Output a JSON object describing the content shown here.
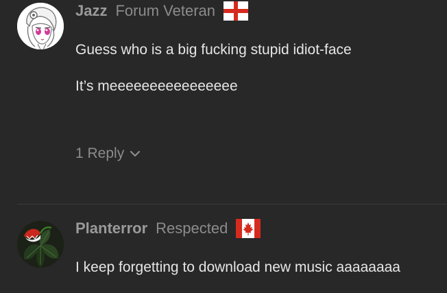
{
  "posts": [
    {
      "author": "Jazz",
      "title": "Forum Veteran",
      "flag_icon": "england-flag-icon",
      "avatar_icon": "anime-girl-avatar",
      "lines": [
        "Guess who is a big fucking stupid idiot-face",
        "It’s meeeeeeeeeeeeeeee"
      ],
      "reply_label": "1 Reply"
    },
    {
      "author": "Planterror",
      "title": "Respected",
      "flag_icon": "canada-flag-icon",
      "avatar_icon": "plant-creature-avatar",
      "lines": [
        "I keep forgetting to download new music aaaaaaaa"
      ]
    }
  ],
  "colors": {
    "background": "#282828",
    "username": "#9a9a9a",
    "secondary_text": "#8c8c8c",
    "body_text": "#e6e6e6",
    "divider": "#3a3a3a",
    "flag_red": "#d52b1e"
  }
}
